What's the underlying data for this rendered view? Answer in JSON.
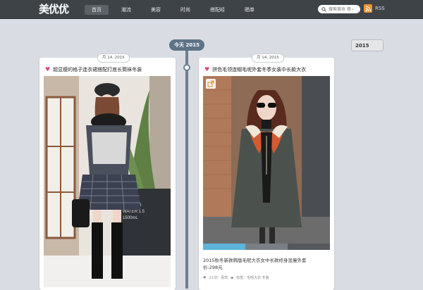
{
  "header": {
    "logo": "美优优",
    "nav": [
      "首页",
      "潮流",
      "美容",
      "时尚",
      "搭配经",
      "晒单"
    ],
    "search_placeholder": "搜索美妆 搭~",
    "rss": "RSS"
  },
  "timeline": {
    "year_pill": "今天 2015",
    "year_button": "2015"
  },
  "cards": [
    {
      "date": "月 14, 2015",
      "title": "超显瘦的格子连衣裙搭配打底长筒袜冬装",
      "share_icon": "share-icon"
    },
    {
      "date": "月 14, 2015",
      "title": "拼色毛领连帽毛呢外套冬季女装中长款大衣",
      "description": "2015秋冬新款韩版毛呢大衣女中长款修身显瘦外套",
      "price": "价:298元",
      "likes": "2135",
      "likes_label": "喜欢",
      "tags": "标签：毛呢大衣 冬装"
    }
  ],
  "colors": {
    "topbar": "#3e4348",
    "accent": "#5d7387",
    "heart": "#e0436e",
    "rss": "#f2922a"
  }
}
